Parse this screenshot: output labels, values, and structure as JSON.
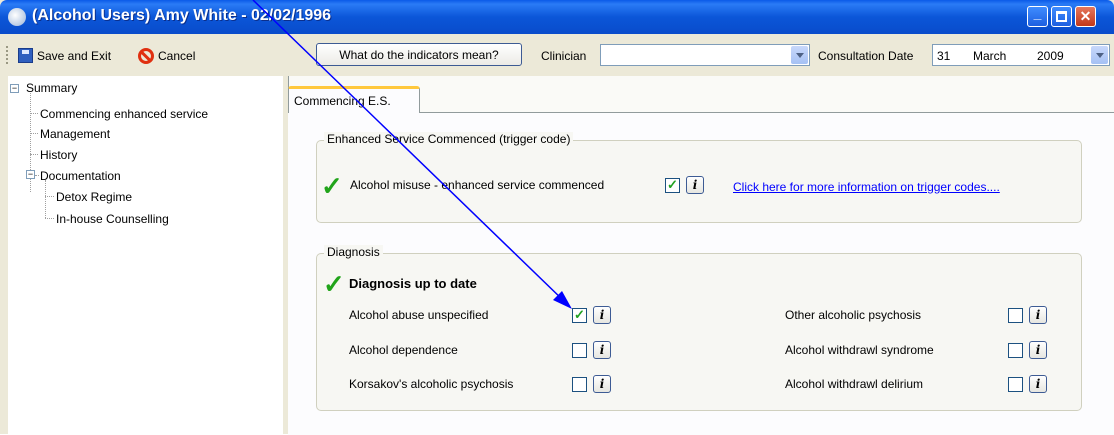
{
  "window": {
    "title": "(Alcohol Users) Amy White - 02/02/1996"
  },
  "toolbar": {
    "save_label": "Save and Exit",
    "cancel_label": "Cancel",
    "indicators_label": "What do the indicators mean?",
    "clinician_label": "Clinician",
    "clinician_value": "",
    "consult_label": "Consultation Date",
    "consult_day": "31",
    "consult_month": "March",
    "consult_year": "2009"
  },
  "tree": {
    "root": "Summary",
    "items": [
      "Commencing enhanced service",
      "Management",
      "History",
      "Documentation"
    ],
    "doc_children": [
      "Detox Regime",
      "In-house Counselling"
    ]
  },
  "tab": {
    "label": "Commencing E.S."
  },
  "enhanced": {
    "legend": "Enhanced Service Commenced (trigger code)",
    "item_label": "Alcohol misuse - enhanced service commenced",
    "item_checked": true,
    "link": "Click here for more information on trigger codes...."
  },
  "diagnosis": {
    "legend": "Diagnosis",
    "status": "Diagnosis up to date",
    "left": [
      {
        "label": "Alcohol abuse unspecified",
        "checked": true
      },
      {
        "label": "Alcohol dependence",
        "checked": false
      },
      {
        "label": "Korsakov's alcoholic psychosis",
        "checked": false
      }
    ],
    "right": [
      {
        "label": "Other alcoholic psychosis",
        "checked": false
      },
      {
        "label": "Alcohol withdrawl syndrome",
        "checked": false
      },
      {
        "label": "Alcohol withdrawl delirium",
        "checked": false
      }
    ]
  },
  "icons": {
    "info_glyph": "i",
    "check_glyph": "✓",
    "minimize": "_",
    "close": "✕"
  },
  "colors": {
    "accent": "#0a5ae8",
    "link": "#0000ff",
    "check": "#21a41a",
    "annotation_arrow": "#0000ff"
  }
}
